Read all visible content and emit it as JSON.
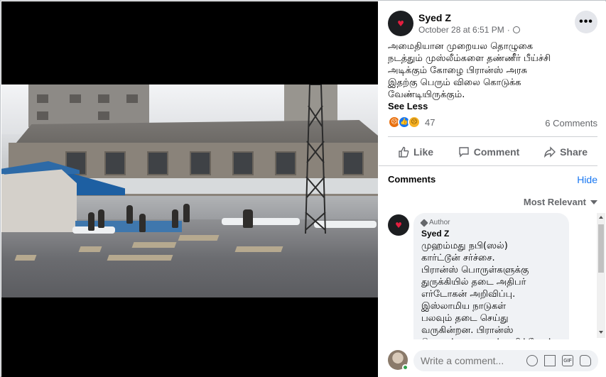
{
  "post": {
    "author": "Syed Z",
    "date": "October 28 at 6:51 PM",
    "text": "அமைதியான முறையல தொழுகை\nநடத்தும் முஸ்லீம்களை தண்ணீர் பீய்ச்சி\nஅடிக்கும் கோழை பிரான்ஸ் அரசு\nஇதற்கு பெரும் விலை கொடுக்க\nவேண்டியிருக்கும்.",
    "see_less": "See Less",
    "reaction_count": "47",
    "comment_count": "6 Comments"
  },
  "actions": {
    "like": "Like",
    "comment": "Comment",
    "share": "Share"
  },
  "comments": {
    "title": "Comments",
    "hide": "Hide",
    "sort": "Most Relevant",
    "items": [
      {
        "badge": "Author",
        "name": "Syed Z",
        "text": "முஹம்மது நபி(ஸல்)\nகார்ட்டூன் சர்ச்சை.\nபிரான்ஸ் பொருள்களுக்கு\nதுருக்கியில் தடை அதிபர்\nஎர்டோகன் அறிவிப்பு.\nஇஸ்லாமிய நாடுகள்\nபலவும் தடை செய்து\nவருகின்றன. பிரான்ஸ்\nபொருட்களை புறக்கணிப்போம்."
      }
    ]
  },
  "composer": {
    "placeholder": "Write a comment..."
  },
  "icons": {
    "more": "more-options-icon",
    "privacy": "globe-icon",
    "like": "thumbs-up-icon",
    "comment": "speech-bubble-icon",
    "share": "share-arrow-icon"
  },
  "colors": {
    "accent": "#1877f2",
    "like_reaction": "#1877f2",
    "angry_reaction": "#e9710f",
    "sad_reaction": "#f7b125",
    "online": "#31a24c"
  }
}
